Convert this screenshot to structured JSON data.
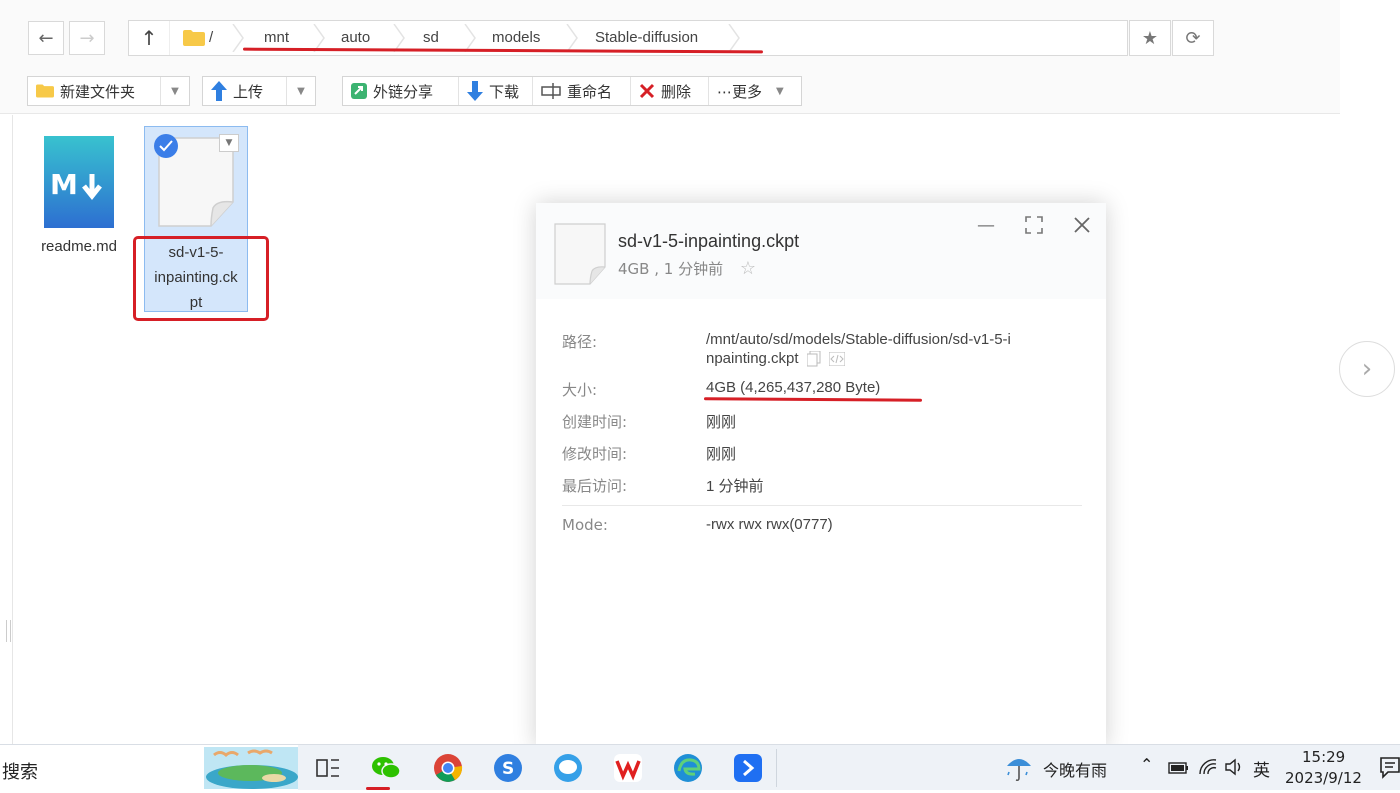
{
  "nav": {
    "back_icon": "arrow-left-icon",
    "forward_icon": "arrow-right-icon",
    "up_icon": "arrow-up-icon",
    "root_label": "/",
    "breadcrumbs": [
      "mnt",
      "auto",
      "sd",
      "models",
      "Stable-diffusion"
    ]
  },
  "toolbar": {
    "new_folder": "新建文件夹",
    "upload": "上传",
    "share_link": "外链分享",
    "download": "下载",
    "rename": "重命名",
    "delete": "删除",
    "more": "⋯更多"
  },
  "files": [
    {
      "name": "readme.md",
      "icon": "markdown-file-icon"
    },
    {
      "name_lines": [
        "sd-v1-5-",
        "inpainting.ck",
        "pt"
      ],
      "icon": "generic-file-icon",
      "selected": true
    }
  ],
  "properties": {
    "title": "sd-v1-5-inpainting.ckpt",
    "subtitle": "4GB , 1 分钟前",
    "path_label": "路径:",
    "path_value_line1": "/mnt/auto/sd/models/Stable-diffusion/sd-v1-5-i",
    "path_value_line2": "npainting.ckpt",
    "size_label": "大小:",
    "size_value": "4GB (4,265,437,280 Byte)",
    "created_label": "创建时间:",
    "created_value": "刚刚",
    "modified_label": "修改时间:",
    "modified_value": "刚刚",
    "accessed_label": "最后访问:",
    "accessed_value": "1 分钟前",
    "mode_label": "Mode:",
    "mode_value": "-rwx rwx rwx(0777)"
  },
  "taskbar": {
    "search": "搜索",
    "weather": "今晚有雨",
    "ime": "英",
    "time": "15:29",
    "date": "2023/9/12"
  },
  "colors": {
    "annotation_red": "#d61f26",
    "selection_blue": "#d4e6fb",
    "accent_blue": "#3b82f6"
  }
}
